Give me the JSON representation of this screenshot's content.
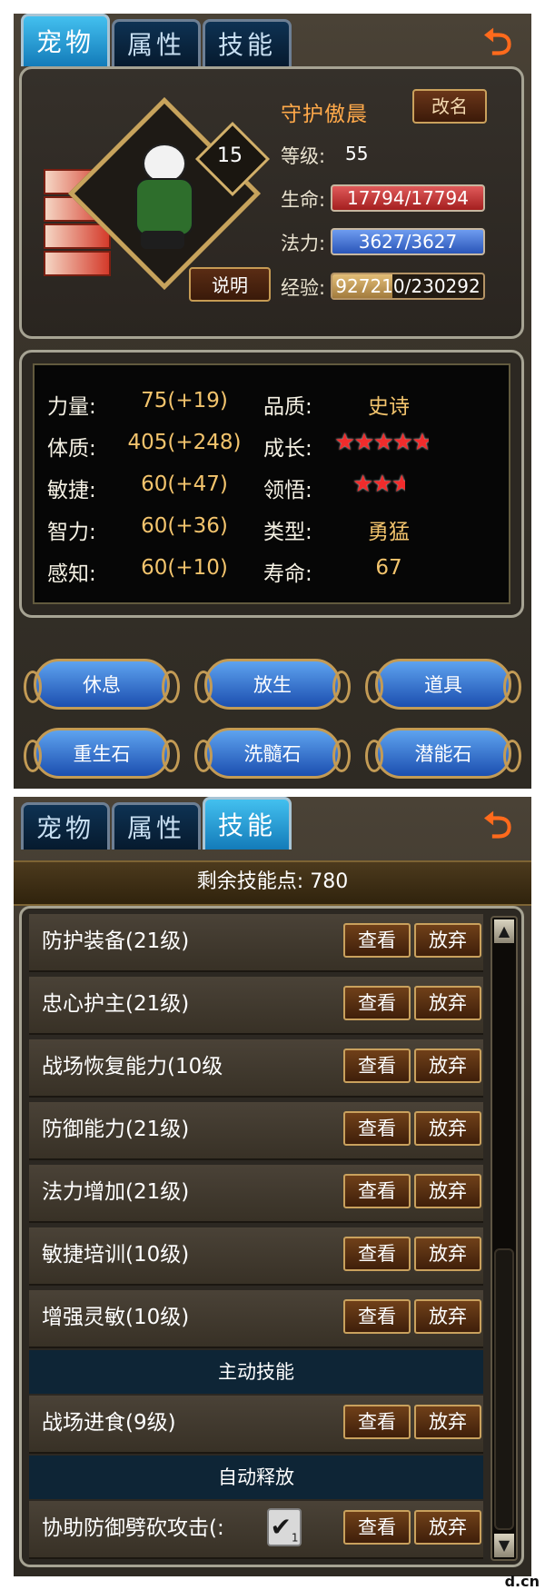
{
  "colors": {
    "tab_active": "#2a9fd8",
    "hp_bar": "#c02828",
    "mp_bar": "#3b6fd1",
    "stat_value": "#f3c46d",
    "name_orange": "#ffa94a"
  },
  "screen1": {
    "tabs": [
      {
        "label": "宠物"
      },
      {
        "label": "属性"
      },
      {
        "label": "技能"
      }
    ],
    "active_tab": 0,
    "back_icon": "back-arrow-icon",
    "pet": {
      "name": "守护傲晨",
      "rename_label": "改名",
      "star_level": "15",
      "desc_label": "说明",
      "level_label": "等级:",
      "level": "55",
      "hp_label": "生命:",
      "hp": "17794/17794",
      "mp_label": "法力:",
      "mp": "3627/3627",
      "exp_label": "经验:",
      "exp": "927210/230292",
      "exp_fill": 0.4
    },
    "stats_left": [
      {
        "label": "力量:",
        "value": "75(+19)"
      },
      {
        "label": "体质:",
        "value": "405(+248)"
      },
      {
        "label": "敏捷:",
        "value": "60(+47)"
      },
      {
        "label": "智力:",
        "value": "60(+36)"
      },
      {
        "label": "感知:",
        "value": "60(+10)"
      }
    ],
    "stats_right": [
      {
        "label": "品质:",
        "value": "史诗"
      },
      {
        "label": "成长:",
        "stars": "★★★★★",
        "rating": 4.5
      },
      {
        "label": "领悟:",
        "stars": "★★★",
        "rating": 2.5
      },
      {
        "label": "类型:",
        "value": "勇猛"
      },
      {
        "label": "寿命:",
        "value": "67"
      }
    ],
    "actions": [
      "休息",
      "放生",
      "道具",
      "重生石",
      "洗髓石",
      "潜能石"
    ]
  },
  "screen2": {
    "tabs": [
      {
        "label": "宠物"
      },
      {
        "label": "属性"
      },
      {
        "label": "技能"
      }
    ],
    "active_tab": 2,
    "remaining_points": "剩余技能点: 780",
    "view_label": "查看",
    "drop_label": "放弃",
    "skills": [
      {
        "name": "防护装备(21级)"
      },
      {
        "name": "忠心护主(21级)"
      },
      {
        "name": "战场恢复能力(10级"
      },
      {
        "name": "防御能力(21级)"
      },
      {
        "name": "法力增加(21级)"
      },
      {
        "name": "敏捷培训(10级)"
      },
      {
        "name": "增强灵敏(10级)"
      }
    ],
    "section_active": "主动技能",
    "active_skills": [
      {
        "name": "战场进食(9级)"
      }
    ],
    "section_auto": "自动释放",
    "auto_skills": [
      {
        "name": "协助防御劈砍攻击(:",
        "checked": true,
        "count": "1"
      }
    ]
  },
  "watermark": "d.cn"
}
